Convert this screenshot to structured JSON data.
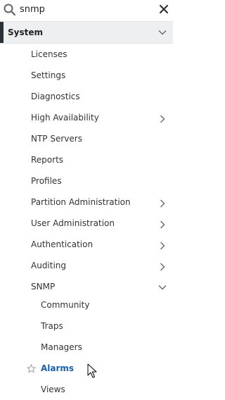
{
  "search": {
    "value": "snmp"
  },
  "section": {
    "title": "System"
  },
  "items": [
    {
      "label": "Licenses"
    },
    {
      "label": "Settings"
    },
    {
      "label": "Diagnostics"
    },
    {
      "label": "High Availability"
    },
    {
      "label": "NTP Servers"
    },
    {
      "label": "Reports"
    },
    {
      "label": "Profiles"
    },
    {
      "label": "Partition Administration"
    },
    {
      "label": "User Administration"
    },
    {
      "label": "Authentication"
    },
    {
      "label": "Auditing"
    },
    {
      "label": "SNMP"
    }
  ],
  "snmp_children": [
    {
      "label": "Community"
    },
    {
      "label": "Traps"
    },
    {
      "label": "Managers"
    },
    {
      "label": "Alarms"
    },
    {
      "label": "Views"
    }
  ],
  "colors": {
    "active_link": "#1a5fae",
    "header_bg": "#eeeff1",
    "accent_bar": "#2b2f36"
  },
  "icons": {
    "search": "search-icon",
    "clear": "close-icon",
    "expanded": "chevron-down-icon",
    "collapsed": "chevron-right-icon",
    "favorite": "star-outline-icon"
  }
}
